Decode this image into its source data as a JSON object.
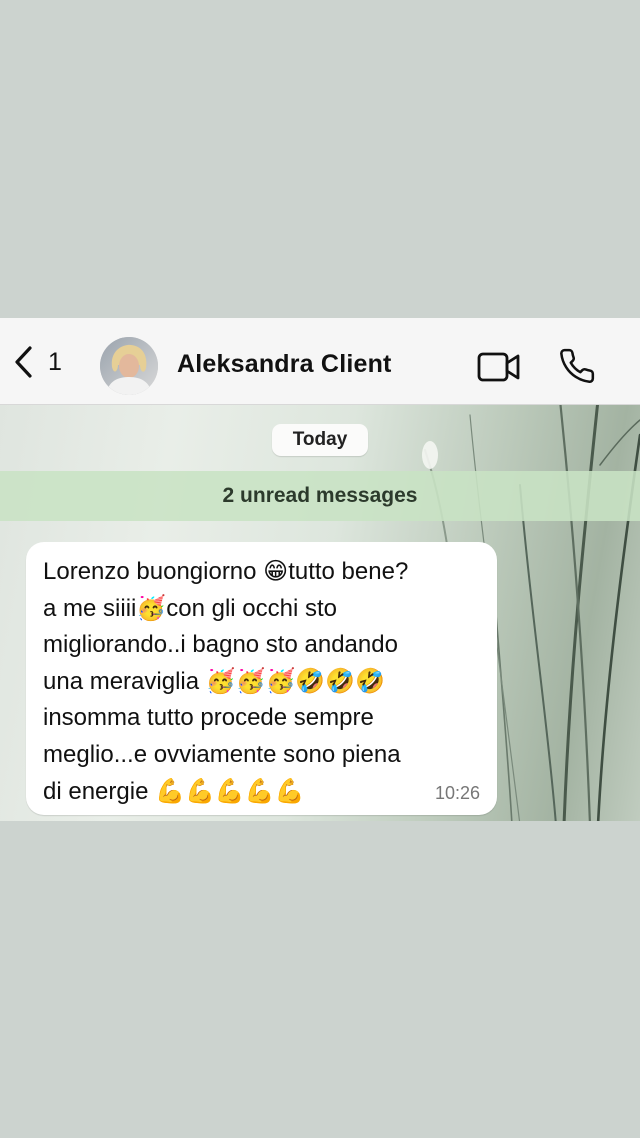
{
  "header": {
    "back_count": "1",
    "contact_name": "Aleksandra Client",
    "avatar_icon": "contact-avatar",
    "video_icon": "video-camera-icon",
    "phone_icon": "phone-icon"
  },
  "chat": {
    "date_label": "Today",
    "unread_label": "2 unread messages",
    "messages": [
      {
        "text": "Lorenzo buongiorno 😁tutto bene?\na me siiii🥳con gli occhi sto\nmigliorando..i bagno sto andando\nuna meraviglia 🥳🥳🥳🤣🤣🤣\ninsomma tutto procede sempre\nmeglio...e ovviamente sono piena\ndi energie 💪💪💪💪💪",
        "time": "10:26",
        "direction": "incoming"
      }
    ]
  },
  "colors": {
    "header_bg": "#f6f6f6",
    "unread_banner_bg": "#c8e2c4",
    "bubble_bg": "#ffffff",
    "page_bg": "#ccd3cf"
  }
}
